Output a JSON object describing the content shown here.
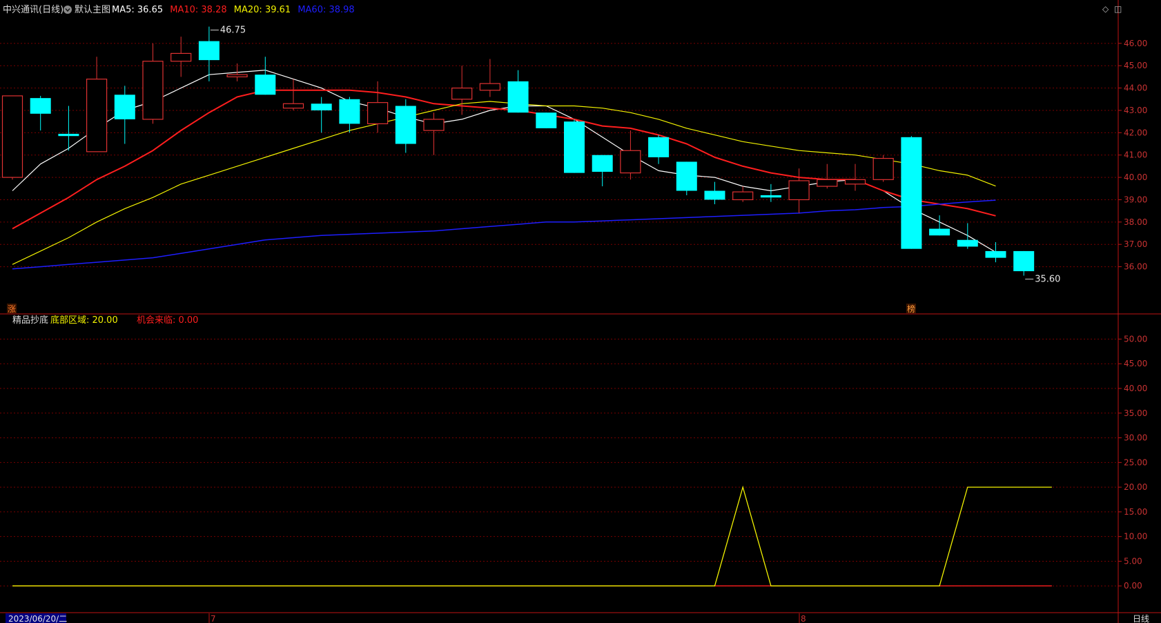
{
  "header": {
    "stock": "中兴通讯(日线)",
    "indicator_switch": "默认主图",
    "ma": [
      {
        "label": "MA5: 36.65",
        "color": "#ffffff"
      },
      {
        "label": "MA10: 38.28",
        "color": "#ff1e1e"
      },
      {
        "label": "MA20: 39.61",
        "color": "#f2f200"
      },
      {
        "label": "MA60: 38.98",
        "color": "#1e1eff"
      }
    ]
  },
  "sub_header": {
    "name": "精品抄底",
    "items": [
      {
        "label": "底部区域: 20.00",
        "color": "#f2f200"
      },
      {
        "label": "机会来临: 0.00",
        "color": "#ff1e1e"
      }
    ]
  },
  "markers": {
    "max_label": "46.75",
    "min_label": "35.60",
    "zhang": "涨",
    "bang": "榜"
  },
  "footer": {
    "date_label": "2023/06/20/二",
    "month_7": "7",
    "month_8": "8",
    "period_button": "日线"
  },
  "colors": {
    "background": "#000000",
    "grid": "#7a0000",
    "axis": "#c01414",
    "axis_text": "#c83232",
    "up": "#e03232",
    "down": "#00ffff",
    "ma5": "#ffffff",
    "ma10": "#ff1e1e",
    "ma20": "#f2f200",
    "ma60": "#1e1eff",
    "bottom_area": "#f2f200",
    "opportunity": "#ff1e1e"
  },
  "icons": {
    "toolbar": [
      "diamond-icon",
      "window-icon"
    ]
  },
  "chart_data": [
    {
      "type": "candlestick",
      "title": "中兴通讯(日线)",
      "yaxis_ticks": [
        36,
        37,
        38,
        39,
        40,
        41,
        42,
        43,
        44,
        45,
        46
      ],
      "yaxis_tick_labels": [
        "36.00",
        "37.00",
        "38.00",
        "39.00",
        "40.00",
        "41.00",
        "42.00",
        "43.00",
        "44.00",
        "45.00",
        "46.00"
      ],
      "ylim": [
        34.35,
        47.2
      ],
      "candles": [
        {
          "o": 40.0,
          "h": 43.65,
          "l": 39.9,
          "c": 43.65
        },
        {
          "o": 43.55,
          "h": 43.65,
          "l": 42.1,
          "c": 42.85
        },
        {
          "o": 41.95,
          "h": 43.2,
          "l": 41.2,
          "c": 41.85
        },
        {
          "o": 41.15,
          "h": 45.4,
          "l": 41.15,
          "c": 44.4
        },
        {
          "o": 43.7,
          "h": 44.1,
          "l": 41.5,
          "c": 42.6
        },
        {
          "o": 42.6,
          "h": 46.0,
          "l": 42.4,
          "c": 45.2
        },
        {
          "o": 45.2,
          "h": 46.3,
          "l": 44.5,
          "c": 45.55
        },
        {
          "o": 46.1,
          "h": 46.75,
          "l": 44.3,
          "c": 45.25
        },
        {
          "o": 44.5,
          "h": 45.1,
          "l": 44.3,
          "c": 44.6
        },
        {
          "o": 44.6,
          "h": 45.4,
          "l": 43.7,
          "c": 43.7
        },
        {
          "o": 43.1,
          "h": 44.4,
          "l": 43.0,
          "c": 43.3
        },
        {
          "o": 43.3,
          "h": 43.6,
          "l": 42.0,
          "c": 43.0
        },
        {
          "o": 43.5,
          "h": 43.6,
          "l": 42.0,
          "c": 42.4
        },
        {
          "o": 42.4,
          "h": 44.3,
          "l": 42.0,
          "c": 43.35
        },
        {
          "o": 43.2,
          "h": 43.5,
          "l": 41.1,
          "c": 41.5
        },
        {
          "o": 42.1,
          "h": 42.9,
          "l": 41.0,
          "c": 42.6
        },
        {
          "o": 43.5,
          "h": 45.0,
          "l": 42.8,
          "c": 44.0
        },
        {
          "o": 43.9,
          "h": 45.3,
          "l": 43.6,
          "c": 44.2
        },
        {
          "o": 44.3,
          "h": 44.8,
          "l": 42.9,
          "c": 42.9
        },
        {
          "o": 42.9,
          "h": 42.9,
          "l": 42.2,
          "c": 42.2
        },
        {
          "o": 42.5,
          "h": 42.6,
          "l": 40.2,
          "c": 40.2
        },
        {
          "o": 41.0,
          "h": 41.0,
          "l": 39.6,
          "c": 40.25
        },
        {
          "o": 40.2,
          "h": 42.1,
          "l": 39.9,
          "c": 41.2
        },
        {
          "o": 41.8,
          "h": 41.9,
          "l": 40.6,
          "c": 40.9
        },
        {
          "o": 40.7,
          "h": 40.7,
          "l": 39.2,
          "c": 39.4
        },
        {
          "o": 39.4,
          "h": 39.8,
          "l": 38.8,
          "c": 39.0
        },
        {
          "o": 39.0,
          "h": 39.6,
          "l": 38.9,
          "c": 39.35
        },
        {
          "o": 39.2,
          "h": 39.7,
          "l": 38.9,
          "c": 39.1
        },
        {
          "o": 39.0,
          "h": 40.4,
          "l": 38.4,
          "c": 39.85
        },
        {
          "o": 39.6,
          "h": 40.6,
          "l": 39.5,
          "c": 39.9
        },
        {
          "o": 39.7,
          "h": 40.6,
          "l": 39.4,
          "c": 39.9
        },
        {
          "o": 39.9,
          "h": 41.0,
          "l": 39.8,
          "c": 40.85
        },
        {
          "o": 41.8,
          "h": 41.85,
          "l": 36.8,
          "c": 36.8
        },
        {
          "o": 37.7,
          "h": 38.3,
          "l": 37.4,
          "c": 37.4
        },
        {
          "o": 37.2,
          "h": 37.95,
          "l": 36.8,
          "c": 36.9
        },
        {
          "o": 36.7,
          "h": 37.1,
          "l": 36.2,
          "c": 36.4
        },
        {
          "o": 36.7,
          "h": 36.7,
          "l": 35.6,
          "c": 35.8
        }
      ],
      "series": [
        {
          "name": "MA5",
          "values": [
            39.4,
            40.6,
            41.3,
            42.2,
            43.0,
            43.4,
            44.0,
            44.6,
            44.7,
            44.8,
            44.4,
            44.0,
            43.4,
            43.1,
            42.7,
            42.4,
            42.6,
            43.0,
            43.2,
            43.2,
            42.6,
            41.8,
            41.0,
            40.3,
            40.1,
            40.0,
            39.6,
            39.4,
            39.6,
            39.8,
            39.9,
            39.4,
            38.6,
            38.0,
            37.4,
            36.65
          ]
        },
        {
          "name": "MA10",
          "values": [
            37.7,
            38.4,
            39.1,
            39.9,
            40.5,
            41.2,
            42.1,
            42.9,
            43.6,
            43.9,
            43.9,
            43.9,
            43.9,
            43.8,
            43.6,
            43.3,
            43.2,
            43.1,
            43.0,
            42.8,
            42.6,
            42.3,
            42.2,
            41.9,
            41.5,
            40.9,
            40.5,
            40.2,
            40.0,
            39.9,
            39.9,
            39.4,
            39.0,
            38.8,
            38.6,
            38.28
          ]
        },
        {
          "name": "MA20",
          "values": [
            36.1,
            36.7,
            37.3,
            38.0,
            38.6,
            39.1,
            39.7,
            40.1,
            40.5,
            40.9,
            41.3,
            41.7,
            42.1,
            42.4,
            42.7,
            43.0,
            43.3,
            43.4,
            43.3,
            43.2,
            43.2,
            43.1,
            42.9,
            42.6,
            42.2,
            41.9,
            41.6,
            41.4,
            41.2,
            41.1,
            41.0,
            40.8,
            40.6,
            40.3,
            40.1,
            39.61
          ]
        },
        {
          "name": "MA60",
          "values": [
            35.9,
            36.0,
            36.1,
            36.2,
            36.3,
            36.4,
            36.6,
            36.8,
            37.0,
            37.2,
            37.3,
            37.4,
            37.45,
            37.5,
            37.55,
            37.6,
            37.7,
            37.8,
            37.9,
            38.0,
            38.0,
            38.05,
            38.1,
            38.15,
            38.2,
            38.25,
            38.3,
            38.35,
            38.4,
            38.5,
            38.55,
            38.65,
            38.7,
            38.8,
            38.9,
            38.98
          ]
        }
      ]
    },
    {
      "type": "line",
      "title": "精品抄底",
      "yaxis_ticks": [
        0,
        5,
        10,
        15,
        20,
        25,
        30,
        35,
        40,
        45,
        50
      ],
      "yaxis_tick_labels": [
        "0.00",
        "5.00",
        "10.00",
        "15.00",
        "20.00",
        "25.00",
        "30.00",
        "35.00",
        "40.00",
        "45.00",
        "50.00"
      ],
      "ylim": [
        -5,
        53
      ],
      "series": [
        {
          "name": "底部区域",
          "values": [
            0,
            0,
            0,
            0,
            0,
            0,
            0,
            0,
            0,
            0,
            0,
            0,
            0,
            0,
            0,
            0,
            0,
            0,
            0,
            0,
            0,
            0,
            0,
            0,
            0,
            0,
            20,
            0,
            0,
            0,
            0,
            0,
            0,
            0,
            20,
            20,
            20,
            20
          ]
        },
        {
          "name": "机会来临",
          "values": [
            0,
            0,
            0,
            0,
            0,
            0,
            0,
            0,
            0,
            0,
            0,
            0,
            0,
            0,
            0,
            0,
            0,
            0,
            0,
            0,
            0,
            0,
            0,
            0,
            0,
            0,
            0,
            0,
            0,
            0,
            0,
            0,
            0,
            0,
            0,
            0,
            0,
            0
          ]
        }
      ]
    }
  ]
}
